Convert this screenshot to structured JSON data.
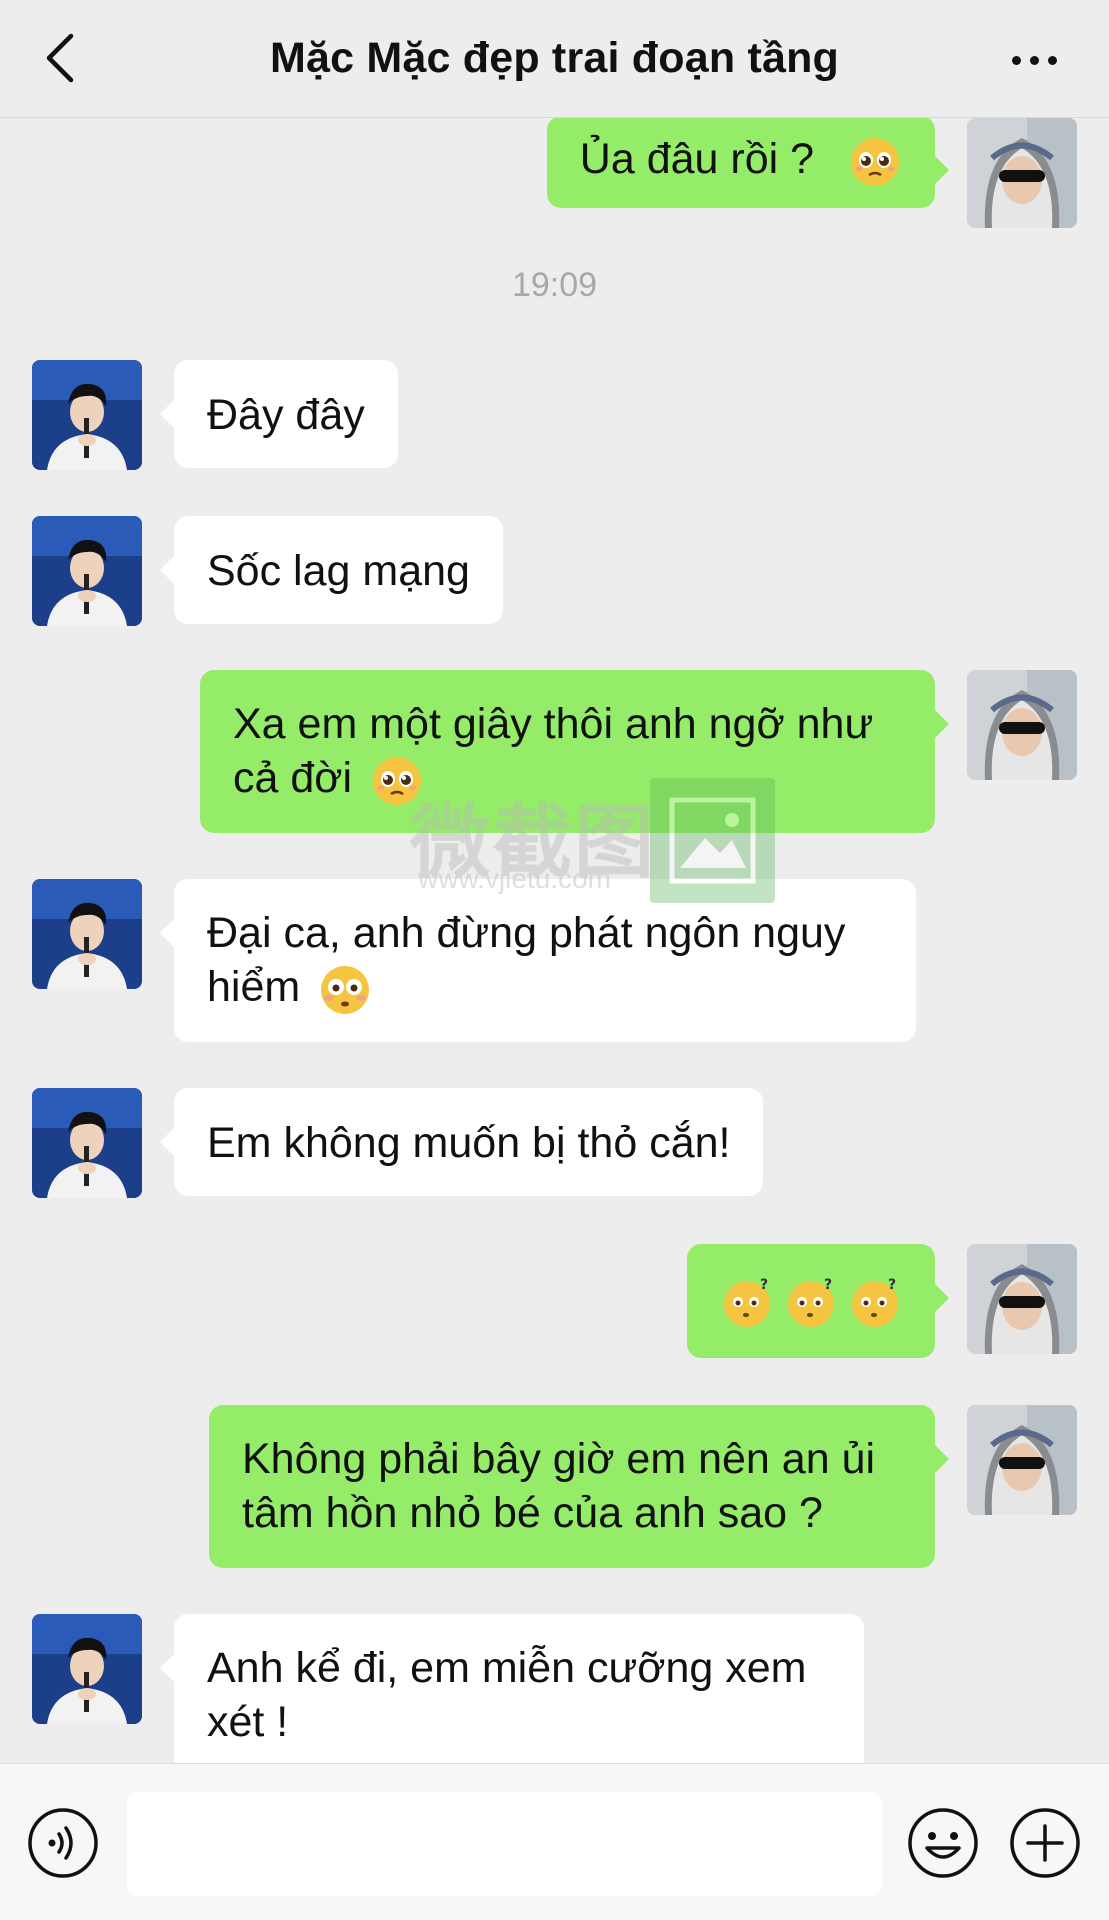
{
  "header": {
    "title": "Mặc Mặc đẹp trai đoạn tầng"
  },
  "messages": [
    {
      "id": "m1",
      "side": "out",
      "text": "Ủa đâu rồi ?",
      "emoji": "pleading-face"
    },
    {
      "id": "ts1",
      "type": "timestamp",
      "text": "19:09"
    },
    {
      "id": "m2",
      "side": "in",
      "text": "Đây đây"
    },
    {
      "id": "m3",
      "side": "in",
      "text": "Sốc lag mạng"
    },
    {
      "id": "m4",
      "side": "out",
      "text": "Xa em một giây thôi anh ngỡ như cả đời",
      "emoji": "pleading-face"
    },
    {
      "id": "m5",
      "side": "in",
      "text": "Đại ca, anh đừng phát ngôn nguy hiểm",
      "emoji": "flushed-face"
    },
    {
      "id": "m6",
      "side": "in",
      "text": "Em không muốn bị thỏ cắn!"
    },
    {
      "id": "m7",
      "side": "out",
      "text": "",
      "emoji": "confused-face-x3"
    },
    {
      "id": "m8",
      "side": "out",
      "text": "Không phải bây giờ em nên an ủi tâm hồn nhỏ bé của anh sao ?"
    },
    {
      "id": "m9",
      "side": "in",
      "text": "Anh kể đi, em miễn cưỡng xem xét !"
    }
  ],
  "watermark": {
    "text": "微截图",
    "url": "www.vjietu.com"
  },
  "input": {
    "value": "",
    "placeholder": ""
  },
  "colors": {
    "outgoing_bubble": "#95ec69",
    "incoming_bubble": "#ffffff",
    "background": "#ededed"
  }
}
